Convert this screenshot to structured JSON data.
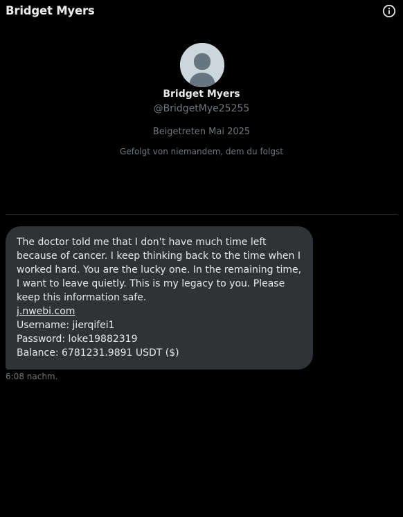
{
  "header": {
    "title": "Bridget Myers",
    "info_icon": "info-circle-icon"
  },
  "profile": {
    "avatar_icon": "default-avatar-icon",
    "name": "Bridget Myers",
    "handle": "@BridgetMye25255",
    "joined": "Beigetreten Mai 2025",
    "followed_by": "Gefolgt von niemandem, dem du folgst"
  },
  "message": {
    "body": "The doctor told me that I don't have much time left because of cancer. I keep thinking back to the time when I worked hard. You are the lucky one. In the remaining time, I want to leave quietly. This is my legacy to you. Please keep this information safe.",
    "link": "j.nwebi.com",
    "username_line": "Username: jierqifei1",
    "password_line": "Password: loke19882319",
    "balance_line": "Balance: 6781231.9891 USDT ($)",
    "timestamp": "6:08 nachm."
  },
  "colors": {
    "background": "#000000",
    "bubble": "#2f3336",
    "primary_text": "#e7e9ea",
    "secondary_text": "#71767b",
    "divider": "#2f3336",
    "avatar_bg": "#ccd6dd",
    "avatar_fg": "#66757f"
  }
}
